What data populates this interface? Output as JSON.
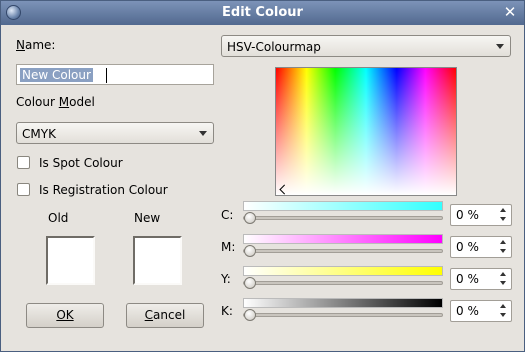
{
  "window": {
    "title": "Edit Colour"
  },
  "form": {
    "name_label": "Name:",
    "name_value": "New Colour",
    "colour_model_label": "Colour Model",
    "colour_model_value": "CMYK",
    "spot_label": "Is Spot Colour",
    "spot_checked": false,
    "registration_label": "Is Registration Colour",
    "registration_checked": false,
    "old_label": "Old",
    "new_label": "New",
    "old_color": "#ffffff",
    "new_color": "#ffffff",
    "ok_label": "OK",
    "cancel_label": "Cancel"
  },
  "picker": {
    "mode_value": "HSV-Colourmap",
    "channels": [
      {
        "label": "C:",
        "value": "0 %",
        "level": 0,
        "gradient_to": "#33ffff"
      },
      {
        "label": "M:",
        "value": "0 %",
        "level": 0,
        "gradient_to": "#ff00ff"
      },
      {
        "label": "Y:",
        "value": "0 %",
        "level": 0,
        "gradient_to": "#ffff00"
      },
      {
        "label": "K:",
        "value": "0 %",
        "level": 0,
        "gradient_to": "#000000"
      }
    ]
  }
}
